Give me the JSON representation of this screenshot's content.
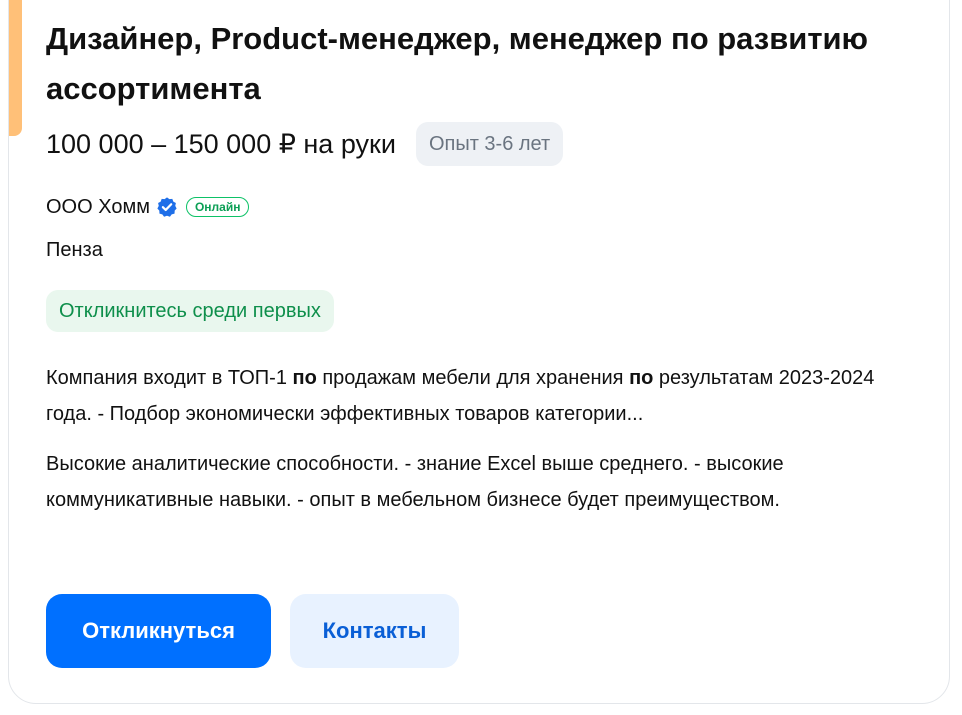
{
  "vacancy": {
    "title": "Дизайнер, Product-менеджер, менеджер по развитию ассортимента",
    "salary": "100 000 – 150 000 ₽ на руки",
    "experience": "Опыт 3-6 лет",
    "company": "ООО Хомм",
    "company_verified_icon": "verified-check-icon",
    "online_label": "Онлайн",
    "city": "Пенза",
    "early_badge": "Откликнитесь среди первых",
    "description_1": {
      "part_1": "Компания входит в ТОП-1 ",
      "bold_1": "по",
      "part_2": " продажам мебели для хранения ",
      "bold_2": "по",
      "part_3": " результатам 2023-2024 года. - Подбор экономически эффективных товаров категории..."
    },
    "description_2": "Высокие аналитические способности. - знание Excel выше среднего. - высокие коммуникативные навыки. - опыт в мебельном бизнесе будет преимуществом."
  },
  "actions": {
    "respond_label": "Откликнуться",
    "contacts_label": "Контакты"
  },
  "colors": {
    "accent_bar": "#ffc078",
    "primary_button": "#0070ff",
    "secondary_button_bg": "#e8f2ff",
    "online_green": "#0dc267",
    "verified_blue": "#1f6fe8"
  }
}
